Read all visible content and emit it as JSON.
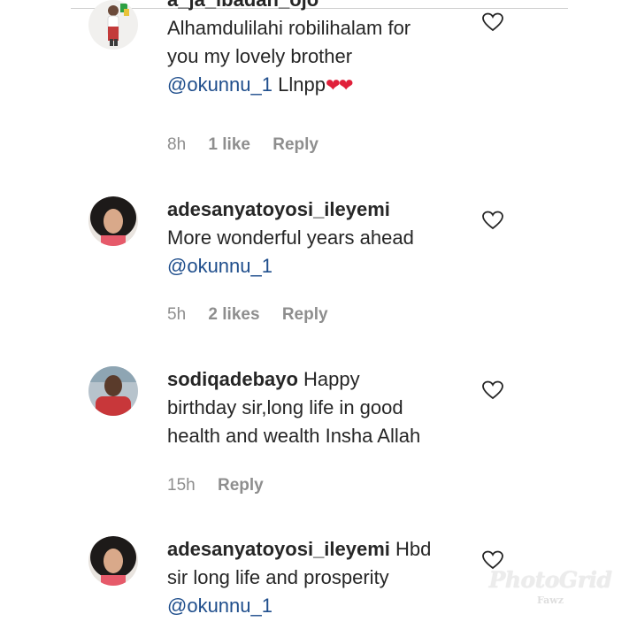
{
  "comments": [
    {
      "username": "a_ja_ibadan_ojo",
      "lines": [
        "Alhamdulilahi robilihalam for",
        "you my lovely brother"
      ],
      "mention": "@okunnu_1",
      "tail": " Llnpp",
      "hearts": "❤❤",
      "time": "8h",
      "likes": "1 like",
      "reply": "Reply"
    },
    {
      "username": "adesanyatoyosi_ileyemi",
      "lines": [
        "More wonderful years ahead"
      ],
      "mention": "@okunnu_1",
      "time": "5h",
      "likes": "2 likes",
      "reply": "Reply"
    },
    {
      "username": "sodiqadebayo",
      "first_text": " Happy",
      "lines": [
        "birthday sir,long life in good",
        "health and wealth Insha Allah"
      ],
      "time": "15h",
      "reply": "Reply"
    },
    {
      "username": "adesanyatoyosi_ileyemi",
      "first_text": " Hbd",
      "lines": [
        "sir long life and prosperity"
      ],
      "mention": "@okunnu_1"
    }
  ],
  "watermark": {
    "main": "PhotoGrid",
    "sub": "Fawz"
  },
  "colors": {
    "mention": "#1f4e8c",
    "meta": "#8e8e8e",
    "heart": "#e0203a"
  }
}
